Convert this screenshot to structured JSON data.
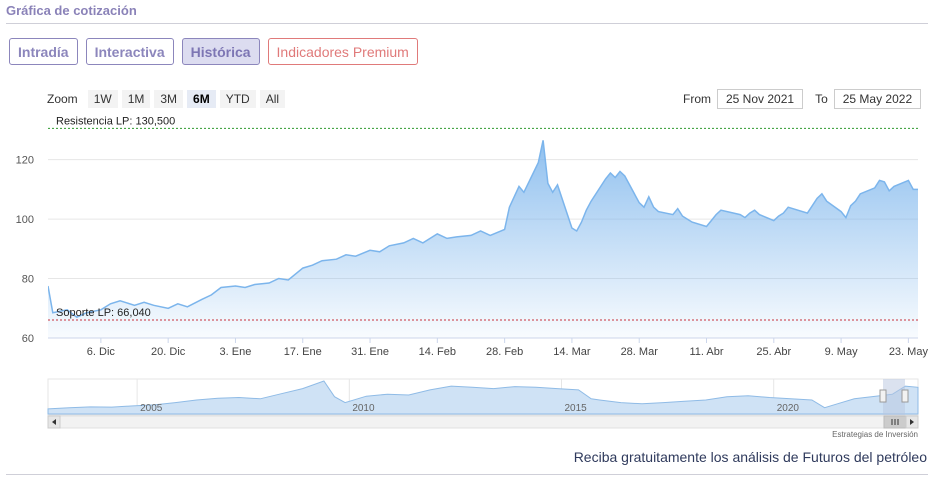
{
  "section_title": "Gráfica de cotización",
  "tabs": [
    {
      "label": "Intradía",
      "active": false
    },
    {
      "label": "Interactiva",
      "active": false
    },
    {
      "label": "Histórica",
      "active": true
    },
    {
      "label": "Indicadores Premium",
      "active": false
    }
  ],
  "zoom": {
    "label": "Zoom",
    "buttons": [
      "1W",
      "1M",
      "3M",
      "6M",
      "YTD",
      "All"
    ],
    "selected": "6M"
  },
  "range": {
    "from_label": "From",
    "from_value": "25 Nov 2021",
    "to_label": "To",
    "to_value": "25 May 2022"
  },
  "chart_data": {
    "type": "area",
    "series": [
      {
        "color": "#7cb5ec",
        "x": [
          "2021-11-25",
          "2021-11-26",
          "2021-11-29",
          "2021-12-01",
          "2021-12-03",
          "2021-12-06",
          "2021-12-08",
          "2021-12-10",
          "2021-12-13",
          "2021-12-15",
          "2021-12-17",
          "2021-12-20",
          "2021-12-22",
          "2021-12-24",
          "2021-12-27",
          "2021-12-29",
          "2021-12-31",
          "2022-01-03",
          "2022-01-05",
          "2022-01-07",
          "2022-01-10",
          "2022-01-12",
          "2022-01-14",
          "2022-01-17",
          "2022-01-19",
          "2022-01-21",
          "2022-01-24",
          "2022-01-26",
          "2022-01-28",
          "2022-01-31",
          "2022-02-02",
          "2022-02-04",
          "2022-02-07",
          "2022-02-09",
          "2022-02-11",
          "2022-02-14",
          "2022-02-16",
          "2022-02-18",
          "2022-02-21",
          "2022-02-23",
          "2022-02-25",
          "2022-02-28",
          "2022-03-01",
          "2022-03-02",
          "2022-03-03",
          "2022-03-04",
          "2022-03-07",
          "2022-03-08",
          "2022-03-09",
          "2022-03-10",
          "2022-03-11",
          "2022-03-14",
          "2022-03-15",
          "2022-03-16",
          "2022-03-17",
          "2022-03-18",
          "2022-03-21",
          "2022-03-22",
          "2022-03-23",
          "2022-03-24",
          "2022-03-25",
          "2022-03-28",
          "2022-03-29",
          "2022-03-30",
          "2022-03-31",
          "2022-04-01",
          "2022-04-04",
          "2022-04-05",
          "2022-04-06",
          "2022-04-07",
          "2022-04-08",
          "2022-04-11",
          "2022-04-12",
          "2022-04-13",
          "2022-04-14",
          "2022-04-18",
          "2022-04-19",
          "2022-04-20",
          "2022-04-21",
          "2022-04-22",
          "2022-04-25",
          "2022-04-26",
          "2022-04-27",
          "2022-04-28",
          "2022-04-29",
          "2022-05-02",
          "2022-05-03",
          "2022-05-04",
          "2022-05-05",
          "2022-05-06",
          "2022-05-09",
          "2022-05-10",
          "2022-05-11",
          "2022-05-12",
          "2022-05-13",
          "2022-05-16",
          "2022-05-17",
          "2022-05-18",
          "2022-05-19",
          "2022-05-20",
          "2022-05-23",
          "2022-05-24",
          "2022-05-25"
        ],
        "y": [
          77.5,
          68.5,
          69.5,
          67.0,
          68.5,
          69.5,
          71.5,
          72.5,
          71.0,
          72.0,
          71.0,
          70.0,
          71.5,
          70.5,
          73.0,
          74.5,
          77.0,
          77.5,
          77.0,
          78.0,
          78.5,
          80.0,
          79.5,
          83.5,
          84.5,
          86.0,
          86.5,
          88.0,
          87.5,
          89.5,
          89.0,
          91.0,
          92.0,
          93.5,
          92.0,
          95.0,
          93.5,
          94.0,
          94.5,
          96.0,
          94.5,
          96.5,
          104.0,
          107.5,
          111.0,
          109.0,
          119.0,
          126.5,
          112.0,
          109.0,
          111.5,
          97.0,
          96.0,
          99.0,
          103.0,
          106.0,
          113.5,
          115.5,
          114.0,
          116.0,
          114.5,
          105.5,
          104.0,
          107.5,
          104.0,
          102.5,
          101.5,
          103.5,
          101.0,
          100.0,
          99.0,
          97.5,
          99.5,
          101.5,
          103.0,
          101.5,
          100.5,
          102.0,
          103.0,
          101.5,
          99.5,
          101.0,
          102.0,
          104.0,
          103.5,
          102.0,
          104.5,
          107.0,
          108.5,
          106.0,
          102.5,
          100.5,
          104.5,
          106.0,
          108.5,
          110.5,
          113.0,
          112.5,
          109.5,
          111.0,
          113.0,
          110.0,
          110.0
        ]
      }
    ],
    "yticks": [
      60,
      80,
      100,
      120
    ],
    "ylim": [
      60,
      134
    ],
    "xticks": [
      {
        "label": "6. Dic",
        "date": "2021-12-06"
      },
      {
        "label": "20. Dic",
        "date": "2021-12-20"
      },
      {
        "label": "3. Ene",
        "date": "2022-01-03"
      },
      {
        "label": "17. Ene",
        "date": "2022-01-17"
      },
      {
        "label": "31. Ene",
        "date": "2022-01-31"
      },
      {
        "label": "14. Feb",
        "date": "2022-02-14"
      },
      {
        "label": "28. Feb",
        "date": "2022-02-28"
      },
      {
        "label": "14. Mar",
        "date": "2022-03-14"
      },
      {
        "label": "28. Mar",
        "date": "2022-03-28"
      },
      {
        "label": "11. Abr",
        "date": "2022-04-11"
      },
      {
        "label": "25. Abr",
        "date": "2022-04-25"
      },
      {
        "label": "9. May",
        "date": "2022-05-09"
      },
      {
        "label": "23. May",
        "date": "2022-05-23"
      }
    ],
    "xlim": [
      "2021-11-25",
      "2022-05-25"
    ],
    "plot_lines": [
      {
        "label": "Resistencia LP: 130,500",
        "value": 130.5,
        "color": "#2e9a2e"
      },
      {
        "label": "Soporte LP: 66,040",
        "value": 66.04,
        "color": "#c8323c"
      }
    ],
    "grid": "horizontal",
    "navigator": {
      "year_labels": [
        "2005",
        "2010",
        "2015",
        "2020"
      ],
      "year_ticks": [
        2004.1,
        2009.1,
        2014.1,
        2019.1
      ],
      "year_range": [
        2002,
        2022.5
      ],
      "years": [
        2002.0,
        2002.5,
        2003.0,
        2003.5,
        2004.0,
        2004.5,
        2005.0,
        2005.5,
        2006.0,
        2006.5,
        2007.0,
        2007.5,
        2008.0,
        2008.5,
        2008.75,
        2009.0,
        2009.5,
        2010.0,
        2010.5,
        2011.0,
        2011.5,
        2012.0,
        2012.5,
        2013.0,
        2013.5,
        2014.0,
        2014.5,
        2014.8,
        2015.0,
        2015.5,
        2016.0,
        2016.5,
        2017.0,
        2017.5,
        2018.0,
        2018.5,
        2019.0,
        2019.5,
        2020.0,
        2020.3,
        2020.6,
        2021.0,
        2021.5,
        2021.9,
        2022.2,
        2022.5
      ],
      "values": [
        20,
        25,
        28,
        27,
        32,
        36,
        45,
        55,
        62,
        65,
        60,
        80,
        100,
        130,
        68,
        45,
        70,
        78,
        75,
        95,
        110,
        105,
        100,
        108,
        105,
        100,
        95,
        60,
        55,
        45,
        40,
        45,
        50,
        55,
        68,
        72,
        65,
        60,
        55,
        25,
        40,
        60,
        70,
        78,
        110,
        105
      ]
    }
  },
  "credit": "Estrategias de Inversión",
  "cta": "Reciba gratuitamente los análisis de Futuros del petróleo"
}
